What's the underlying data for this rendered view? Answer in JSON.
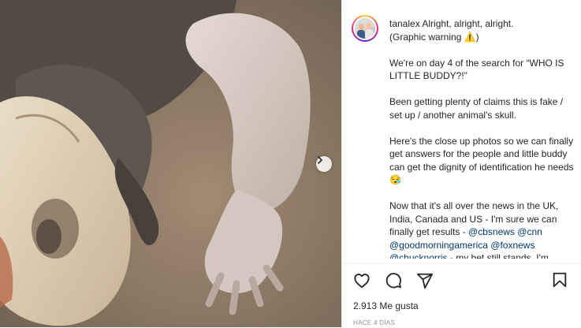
{
  "post": {
    "username": "tanalex",
    "caption": {
      "intro": "Alright, alright, alright.",
      "warning": "(Graphic warning ⚠️)",
      "paragraph1": "We're on day 4 of the search for “WHO IS LITTLE BUDDY?!”",
      "paragraph2": "Been getting plenty of claims this is fake / set up / another animal's skull.",
      "paragraph3": "Here's the close up photos so we can finally get answers for the people and little buddy can get the dignity of identification he needs😪",
      "paragraph4_text": "Now that it's all over the news in the UK, India, Canada and US - I'm sure we can finally get results -",
      "mentions": [
        "@cbsnews",
        "@cnn",
        "@goodmorningamerica",
        "@foxnews",
        "@chucknorris"
      ],
      "paragraph4_tail": "- my bet still stands. I'm"
    },
    "likes_text": "2.913 Me gusta",
    "timestamp": "HACE 4 DÍAS"
  },
  "icons": {
    "like": "heart-icon",
    "comment": "comment-icon",
    "share": "paper-plane-icon",
    "save": "bookmark-icon",
    "carousel_next": "chevron-right-icon"
  },
  "colors": {
    "text": "#262626",
    "mention": "#00376b",
    "muted": "#8e8e8e",
    "border": "#efefef"
  }
}
